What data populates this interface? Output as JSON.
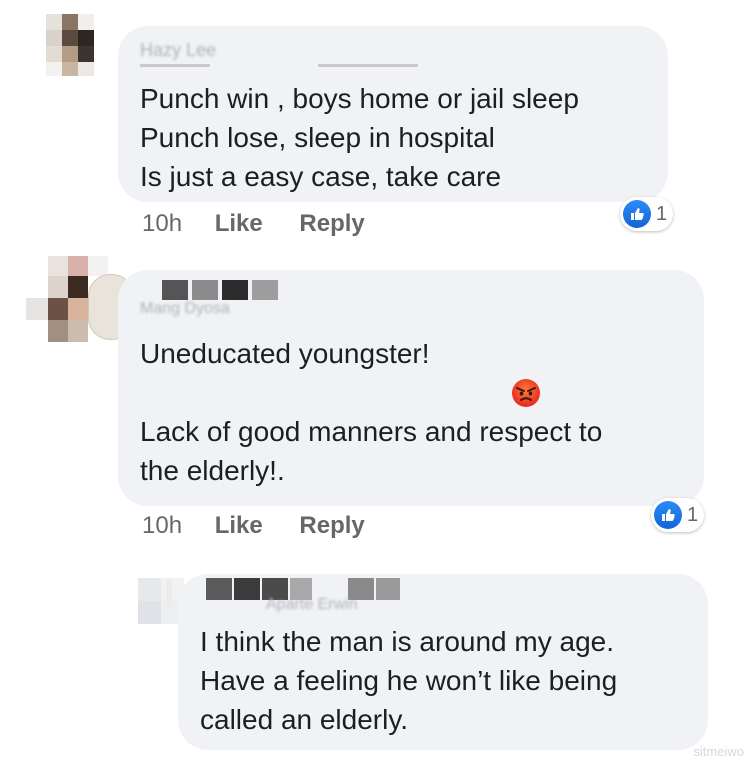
{
  "comments": [
    {
      "author_blurred": "Hazy Lee",
      "lines": [
        "Punch win , boys home or jail sleep",
        "Punch lose, sleep in hospital",
        "Is just a easy case, take care"
      ],
      "time": "10h",
      "like_label": "Like",
      "reply_label": "Reply",
      "reaction_count": "1",
      "reaction_icon": "thumbs-up-icon"
    },
    {
      "author_blurred": "Mang Dyosa",
      "line1": "Uneducated youngster!",
      "emoji_icon": "angry-face-icon",
      "line2": "Lack of good manners and respect to",
      "line3": "the elderly!.",
      "time": "10h",
      "like_label": "Like",
      "reply_label": "Reply",
      "reaction_count": "1",
      "reaction_icon": "thumbs-up-icon"
    },
    {
      "author_blurred": "Aparte Erwin",
      "lines": [
        "I think the man is around my age.",
        "Have a feeling he won’t like being",
        "called an elderly."
      ]
    }
  ],
  "watermark": "sitmeiwo"
}
